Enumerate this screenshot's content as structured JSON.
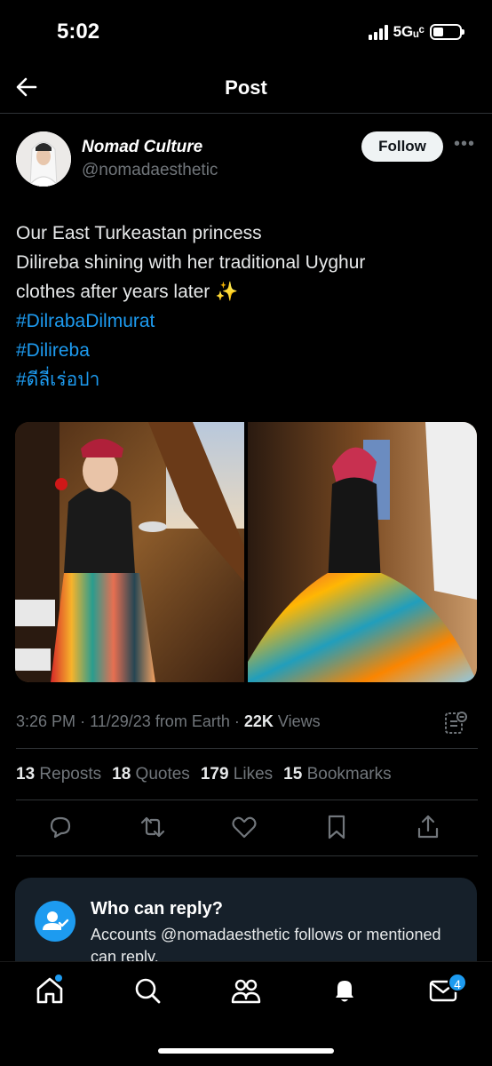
{
  "status_bar": {
    "time": "5:02",
    "network": "5Gᵤᶜ"
  },
  "header": {
    "title": "Post",
    "back_icon": "arrow-left-icon"
  },
  "author": {
    "name": "Nomad Culture",
    "handle": "@nomadaesthetic",
    "follow_label": "Follow",
    "more_label": "•••"
  },
  "tweet": {
    "lines": [
      "Our East Turkeastan princess",
      "Dilireba shining with her traditional Uyghur",
      "clothes after years later ✨"
    ],
    "hashtags": [
      "#DilrabaDilmurat",
      "#Dilireba",
      "#ดีลี่เร่อปา"
    ]
  },
  "meta": {
    "time": "3:26 PM",
    "date": "11/29/23",
    "source": "from Earth",
    "views_count": "22K",
    "views_label": "Views"
  },
  "stats": {
    "reposts_count": "13",
    "reposts_label": "Reposts",
    "quotes_count": "18",
    "quotes_label": "Quotes",
    "likes_count": "179",
    "likes_label": "Likes",
    "bookmarks_count": "15",
    "bookmarks_label": "Bookmarks"
  },
  "reply_settings": {
    "title": "Who can reply?",
    "description": "Accounts @nomadaesthetic follows or mentioned can reply."
  },
  "bottom_nav": {
    "notifications_badge": "4"
  },
  "colors": {
    "accent": "#1d9bf0",
    "background": "#000000",
    "muted": "#71767b"
  }
}
